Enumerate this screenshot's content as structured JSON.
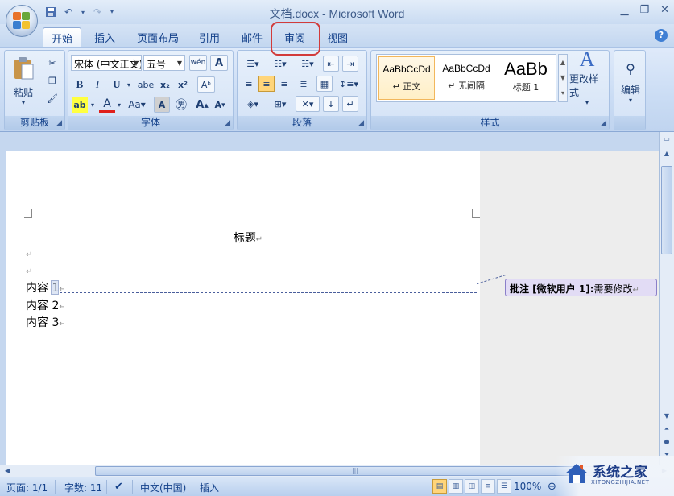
{
  "window": {
    "title": "文档.docx - Microsoft Word"
  },
  "tabs": [
    {
      "label": "开始",
      "active": true
    },
    {
      "label": "插入"
    },
    {
      "label": "页面布局"
    },
    {
      "label": "引用"
    },
    {
      "label": "邮件"
    },
    {
      "label": "审阅",
      "highlighted": true
    },
    {
      "label": "视图"
    }
  ],
  "ribbon": {
    "clipboard": {
      "label": "剪贴板",
      "paste_label": "粘贴"
    },
    "font": {
      "label": "字体",
      "font_name": "宋体 (中文正文)",
      "font_size": "五号"
    },
    "paragraph": {
      "label": "段落"
    },
    "styles": {
      "label": "样式",
      "items": [
        {
          "sample": "AaBbCcDd",
          "name": "↵ 正文",
          "selected": true
        },
        {
          "sample": "AaBbCcDd",
          "name": "↵ 无间隔"
        },
        {
          "sample": "AaBb",
          "name": "标题 1"
        }
      ],
      "change_styles_label": "更改样式"
    },
    "editing": {
      "label": "编辑"
    }
  },
  "document": {
    "title_line": "标题",
    "empty_mark": "↵",
    "lines": [
      "内容 1",
      "内容 2",
      "内容 3"
    ]
  },
  "comment": {
    "prefix": "批注 [",
    "author": "微软用户",
    "index_suffix": " 1]:",
    "text": "需要修改"
  },
  "statusbar": {
    "page": "页面: 1/1",
    "words": "字数: 11",
    "language": "中文(中国)",
    "mode": "插入",
    "zoom": "100%"
  },
  "watermark": {
    "text": "系统之家",
    "sub": "XITONGZHIJIA.NET"
  },
  "colors": {
    "highlight_ring": "#d23b3b",
    "comment_bg": "#e2dcf5"
  }
}
